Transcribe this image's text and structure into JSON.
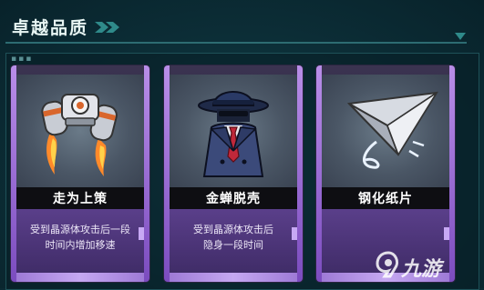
{
  "header": {
    "title": "卓越品质",
    "chevron_icon": "double-chevron-right-icon",
    "collapse_icon": "triangle-down-icon",
    "accent_color": "#2d6c72"
  },
  "cards": [
    {
      "name": "走为上策",
      "description_line1": "受到晶源体攻击后一段",
      "description_line2": "时间内增加移速",
      "icon": "jetpack-icon",
      "rarity_color": "#9b6ad8"
    },
    {
      "name": "金蝉脱壳",
      "description_line1": "受到晶源体攻击后",
      "description_line2": "隐身一段时间",
      "icon": "spy-coat-icon",
      "rarity_color": "#9b6ad8"
    },
    {
      "name": "钢化纸片",
      "description_line1": "",
      "description_line2": "",
      "icon": "paper-plane-icon",
      "rarity_color": "#9b6ad8"
    }
  ],
  "watermark": {
    "text": "九游",
    "logo_icon": "jiuyou-logo-icon"
  }
}
